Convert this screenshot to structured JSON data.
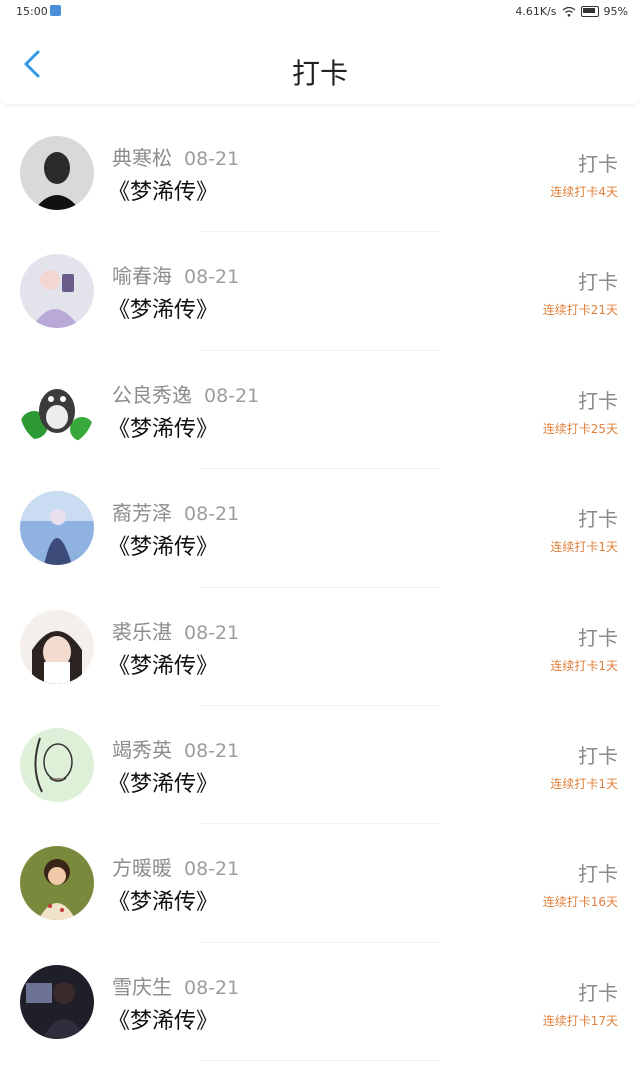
{
  "status_bar": {
    "time": "15:00",
    "network_speed": "4.61K/s",
    "battery": "95%"
  },
  "header": {
    "title": "打卡",
    "back_icon": "chevron-left-icon"
  },
  "colors": {
    "accent_blue": "#2f9be8",
    "streak_orange": "#e0813d",
    "muted_text": "#8c8c8c"
  },
  "items": [
    {
      "name": "典寒松",
      "date": "08-21",
      "book": "《梦浠传》",
      "action": "打卡",
      "streak": "连续打卡4天"
    },
    {
      "name": "喻春海",
      "date": "08-21",
      "book": "《梦浠传》",
      "action": "打卡",
      "streak": "连续打卡21天"
    },
    {
      "name": "公良秀逸",
      "date": "08-21",
      "book": "《梦浠传》",
      "action": "打卡",
      "streak": "连续打卡25天"
    },
    {
      "name": "裔芳泽",
      "date": "08-21",
      "book": "《梦浠传》",
      "action": "打卡",
      "streak": "连续打卡1天"
    },
    {
      "name": "裘乐湛",
      "date": "08-21",
      "book": "《梦浠传》",
      "action": "打卡",
      "streak": "连续打卡1天"
    },
    {
      "name": "竭秀英",
      "date": "08-21",
      "book": "《梦浠传》",
      "action": "打卡",
      "streak": "连续打卡1天"
    },
    {
      "name": "方暖暖",
      "date": "08-21",
      "book": "《梦浠传》",
      "action": "打卡",
      "streak": "连续打卡16天"
    },
    {
      "name": "雪庆生",
      "date": "08-21",
      "book": "《梦浠传》",
      "action": "打卡",
      "streak": "连续打卡17天"
    }
  ]
}
